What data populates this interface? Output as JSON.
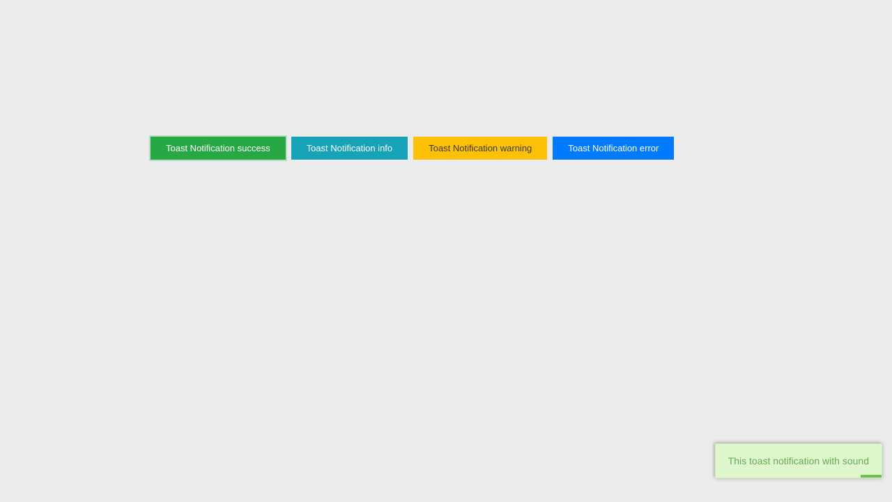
{
  "buttons": {
    "success": {
      "label": "Toast Notification success"
    },
    "info": {
      "label": "Toast Notification info"
    },
    "warning": {
      "label": "Toast Notification warning"
    },
    "error": {
      "label": "Toast Notification error"
    }
  },
  "toast": {
    "message": "This toast notification with sound",
    "type": "success"
  }
}
